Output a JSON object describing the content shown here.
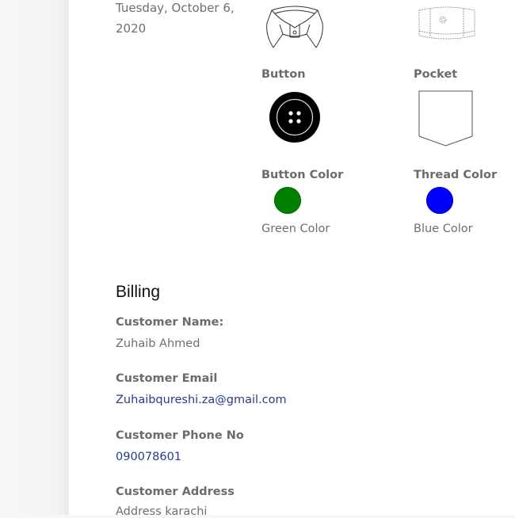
{
  "order": {
    "date": "Tuesday, October 6, 2020"
  },
  "options": {
    "button": {
      "label": "Button",
      "icon": "shirt-button-icon"
    },
    "pocket": {
      "label": "Pocket",
      "icon": "shirt-pocket-icon"
    },
    "collar": {
      "icon": "shirt-collar-icon"
    },
    "cuff": {
      "icon": "shirt-cuff-icon"
    },
    "button_color": {
      "label": "Button Color",
      "value": "Green Color",
      "color": "#008000"
    },
    "thread_color": {
      "label": "Thread Color",
      "value": "Blue Color",
      "color": "#0000ff"
    }
  },
  "billing": {
    "title": "Billing",
    "customer_name": {
      "label": "Customer Name:",
      "value": "Zuhaib Ahmed"
    },
    "customer_email": {
      "label": "Customer Email",
      "value": "Zuhaibqureshi.za@gmail.com"
    },
    "customer_phone": {
      "label": "Customer Phone No",
      "value": "090078601"
    },
    "customer_address": {
      "label": "Customer Address",
      "value": "Address karachi"
    }
  }
}
